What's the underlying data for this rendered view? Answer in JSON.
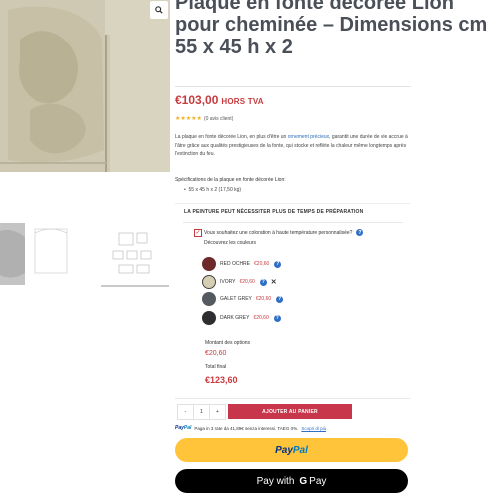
{
  "product": {
    "title": "Plaque en fonte décorée Lion pour cheminée – Dimensions cm 55 x 45 h x 2",
    "price": "€103,00",
    "tax_label": "HORS TVA",
    "rating_text": "(0 avis client)",
    "description_pre": "La plaque en fonte décorée Lion, en plus d'être un ",
    "description_highlight": "ornement précieux",
    "description_post": ", garantit une durée de vie accrue à l'âtre grâce aux qualités prestigieuses de la fonte, qui stocke et reflète la chaleur même longtemps après l'extinction du feu.",
    "specs_title": "Spécifications de la plaque en fonte décorée Lion:",
    "specs": [
      "55 x 45 h x 2 (17,50 kg)"
    ]
  },
  "options": {
    "warning": "LA PEINTURE PEUT NÉCESSITER PLUS DE TEMPS DE PRÉPARATION",
    "checkbox_label": "Vous souhaitez une coloration à haute température personnalisée?",
    "colors_label": "Découvrez les couleurs",
    "colors": [
      {
        "name": "RED OCHRE",
        "price": "€20,60",
        "hex": "#6e2a2a"
      },
      {
        "name": "IVORY",
        "price": "€20,60",
        "hex": "#d6ceb3"
      },
      {
        "name": "GALET GREY",
        "price": "€20,60",
        "hex": "#555a60"
      },
      {
        "name": "DARK GREY",
        "price": "€20,60",
        "hex": "#2e2e30"
      }
    ],
    "options_total_label": "Montant des options",
    "options_total": "€20,60",
    "final_label": "Total final",
    "final_total": "€123,60"
  },
  "cart": {
    "minus": "-",
    "quantity": "1",
    "plus": "+",
    "add_label": "AJOUTER AU PANIER"
  },
  "paypal": {
    "message_pay": "Pay",
    "message_pal": "Pal",
    "message": "Paga in 3 rate da 41,89€ senza interessi. TAEG 0%.",
    "link": "Scopri di più",
    "button_pay": "Pay",
    "button_pal": "Pal"
  },
  "gpay": {
    "prefix": "Pay with",
    "g": "G",
    "suffix": "Pay"
  },
  "colors": {
    "accent": "#c73a3e",
    "title": "#4b5058",
    "paypal_yellow": "#ffc439"
  }
}
